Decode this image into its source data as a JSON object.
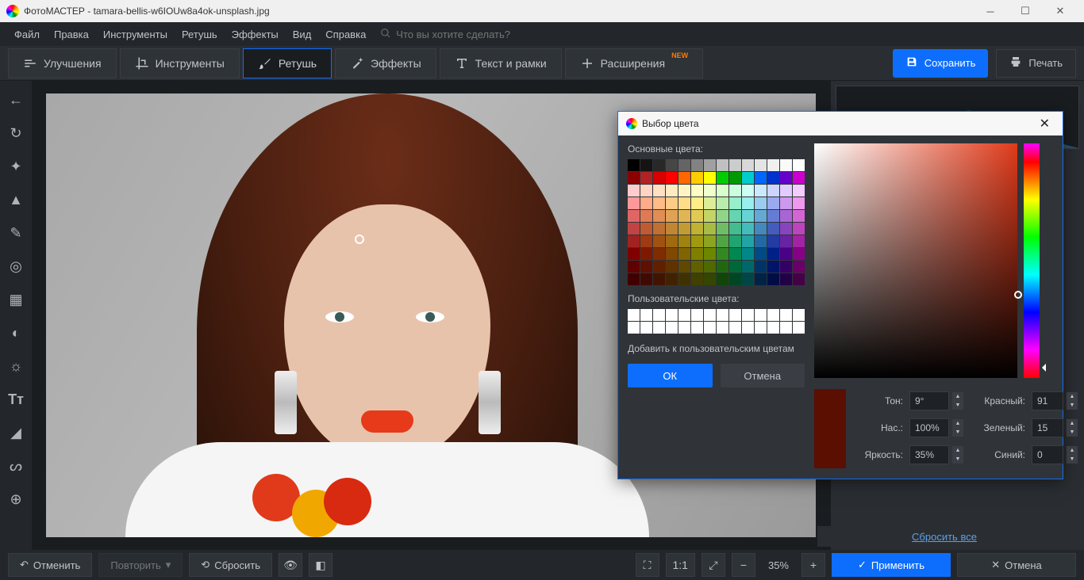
{
  "titlebar": {
    "app": "ФотоМАСТЕР",
    "file": "tamara-bellis-w6IOUw8a4ok-unsplash.jpg"
  },
  "menu": {
    "items": [
      "Файл",
      "Правка",
      "Инструменты",
      "Ретушь",
      "Эффекты",
      "Вид",
      "Справка"
    ],
    "search_placeholder": "Что вы хотите сделать?"
  },
  "tabs": {
    "enhance": "Улучшения",
    "tools": "Инструменты",
    "retouch": "Ретушь",
    "effects": "Эффекты",
    "text": "Текст и рамки",
    "extensions": "Расширения",
    "new_badge": "NEW"
  },
  "actions": {
    "save": "Сохранить",
    "print": "Печать"
  },
  "color_modal": {
    "title": "Выбор цвета",
    "basic_label": "Основные цвета:",
    "custom_label": "Пользовательские цвета:",
    "basic_colors": [
      "#000000",
      "#141414",
      "#282828",
      "#464646",
      "#646464",
      "#828282",
      "#a0a0a0",
      "#c0c0c0",
      "#cccccc",
      "#d8d8d8",
      "#e4e4e4",
      "#f0f0f0",
      "#fafafa",
      "#ffffff",
      "#8b0000",
      "#b22222",
      "#d80000",
      "#ff0000",
      "#ff6600",
      "#ffcc00",
      "#ffff00",
      "#00cc00",
      "#009900",
      "#00cccc",
      "#0066ff",
      "#0033cc",
      "#6600cc",
      "#cc00cc",
      "#ffcccc",
      "#ffd4c2",
      "#ffe0c2",
      "#ffeac2",
      "#fff4c2",
      "#fffec2",
      "#f0ffcc",
      "#d8ffcc",
      "#ccffe0",
      "#ccfff4",
      "#cce8ff",
      "#ccd4ff",
      "#e0ccff",
      "#f4ccff",
      "#ff9999",
      "#ffaa88",
      "#ffbb88",
      "#ffcc88",
      "#ffdd88",
      "#ffee88",
      "#ddee99",
      "#b8eeaa",
      "#99eecc",
      "#99eeee",
      "#99ccee",
      "#99aaee",
      "#cc99ee",
      "#ee99ee",
      "#e06666",
      "#e07a55",
      "#e08e55",
      "#e0a255",
      "#e0b655",
      "#e0ca55",
      "#c4d466",
      "#90d488",
      "#66d4b0",
      "#66d4d4",
      "#66a8d4",
      "#667cd4",
      "#a866d4",
      "#d466d4",
      "#c04444",
      "#c05a33",
      "#c07033",
      "#c08633",
      "#c09c33",
      "#c0b233",
      "#a8bc44",
      "#70bc66",
      "#44bc90",
      "#44bcbc",
      "#4488bc",
      "#445cbc",
      "#8844bc",
      "#bc44bc",
      "#a02222",
      "#a03a11",
      "#a05211",
      "#a06a11",
      "#a08211",
      "#a09a11",
      "#8ca422",
      "#50a444",
      "#22a470",
      "#22a4a4",
      "#2268a4",
      "#223ca4",
      "#6822a4",
      "#a422a4",
      "#800000",
      "#801800",
      "#802c00",
      "#804800",
      "#806400",
      "#808000",
      "#6c8800",
      "#348822",
      "#008850",
      "#008888",
      "#004a88",
      "#002088",
      "#4a0088",
      "#880088",
      "#600000",
      "#601000",
      "#602000",
      "#603200",
      "#604800",
      "#606000",
      "#506800",
      "#206810",
      "#006838",
      "#006868",
      "#003468",
      "#001468",
      "#340068",
      "#680068",
      "#400000",
      "#400a00",
      "#401400",
      "#402200",
      "#403200",
      "#404000",
      "#344600",
      "#104608",
      "#004624",
      "#004646",
      "#002246",
      "#000c46",
      "#220046",
      "#460046"
    ],
    "add_custom": "Добавить к пользовательским цветам",
    "ok": "ОК",
    "cancel": "Отмена",
    "hue_label": "Тон:",
    "hue_val": "9°",
    "sat_label": "Нас.:",
    "sat_val": "100%",
    "bri_label": "Яркость:",
    "bri_val": "35%",
    "r_label": "Красный:",
    "r_val": "91",
    "g_label": "Зеленый:",
    "g_val": "15",
    "b_label": "Синий:",
    "b_val": "0",
    "current_hex": "#5b0f00"
  },
  "reset_all": "Сбросить все",
  "bottom": {
    "undo": "Отменить",
    "redo": "Повторить",
    "reset": "Сбросить",
    "ratio": "1:1",
    "zoom": "35%",
    "apply": "Применить",
    "cancel": "Отмена"
  }
}
